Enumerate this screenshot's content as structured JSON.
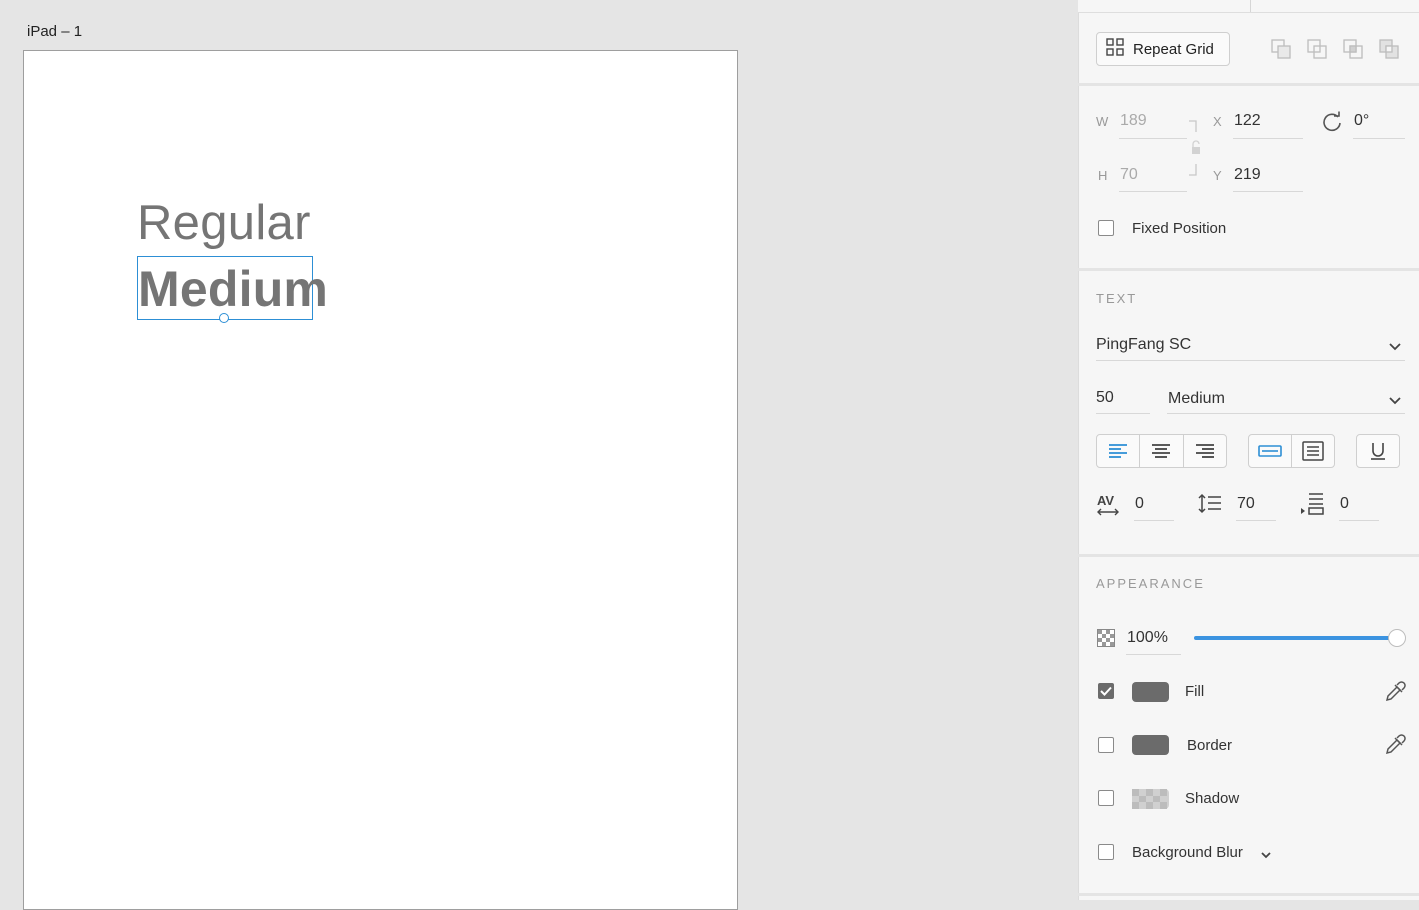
{
  "canvas": {
    "artboard_label": "iPad – 1",
    "text_regular": "Regular",
    "text_medium": "Medium"
  },
  "toolbar": {
    "repeat_grid_label": "Repeat Grid"
  },
  "transform": {
    "w_label": "W",
    "w_value": "189",
    "h_label": "H",
    "h_value": "70",
    "x_label": "X",
    "x_value": "122",
    "y_label": "Y",
    "y_value": "219",
    "rotation_value": "0°",
    "fixed_position_label": "Fixed Position",
    "fixed_position_checked": false
  },
  "text": {
    "section_title": "TEXT",
    "font_family": "PingFang SC",
    "font_size": "50",
    "font_weight": "Medium",
    "char_spacing": "0",
    "line_spacing": "70",
    "paragraph_spacing": "0",
    "align": "left",
    "box_mode": "auto-width"
  },
  "appearance": {
    "section_title": "APPEARANCE",
    "opacity": "100%",
    "opacity_fraction": 1.0,
    "fill_label": "Fill",
    "fill_checked": true,
    "fill_color": "#6b6b6b",
    "border_label": "Border",
    "border_checked": false,
    "border_color": "#6b6b6b",
    "shadow_label": "Shadow",
    "shadow_checked": false,
    "background_blur_label": "Background Blur",
    "background_blur_checked": false
  },
  "colors": {
    "accent": "#2d8fd5",
    "slider": "#3b93e0",
    "text_sample": "#757575"
  }
}
